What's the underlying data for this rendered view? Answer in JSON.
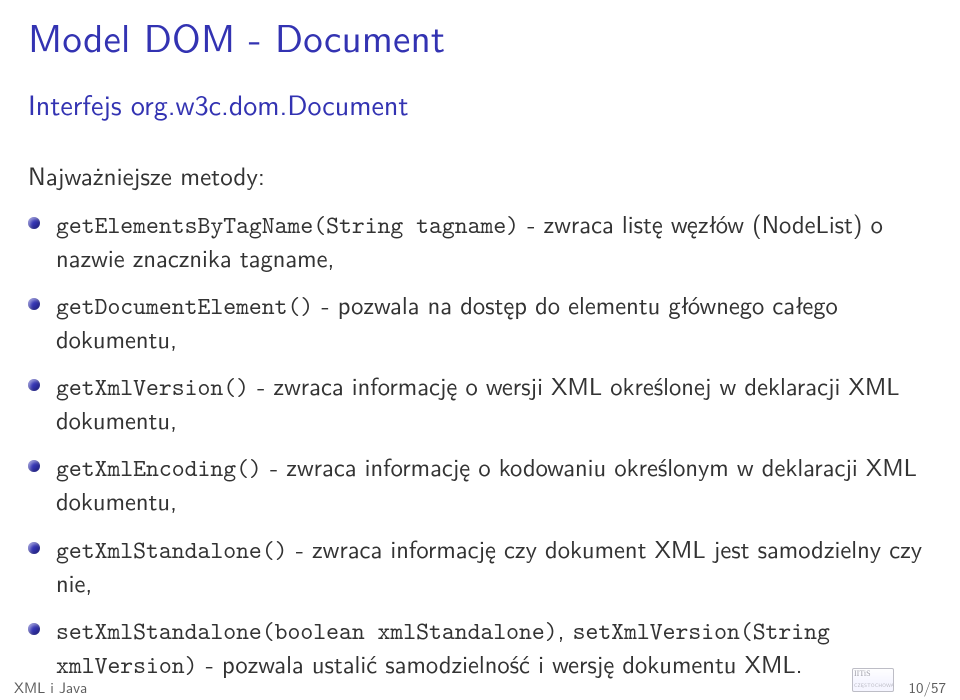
{
  "title": "Model DOM - Document",
  "subtitle": "Interfejs org.w3c.dom.Document",
  "block_title": "Najważniejsze metody:",
  "items": [
    {
      "code": "getElementsByTagName(String tagname)",
      "rest": " - zwraca listę węzłów (NodeList) o nazwie znacznika tagname,"
    },
    {
      "code": "getDocumentElement()",
      "rest": " - pozwala na dostęp do elementu głównego całego dokumentu,"
    },
    {
      "code": "getXmlVersion()",
      "rest": " - zwraca informację o wersji XML określonej w deklaracji XML dokumentu,"
    },
    {
      "code": "getXmlEncoding()",
      "rest": " - zwraca informację o kodowaniu określonym w deklaracji XML dokumentu,"
    },
    {
      "code": "getXmlStandalone()",
      "rest": " - zwraca informację czy dokument XML jest samodzielny czy nie,"
    },
    {
      "code": "setXmlStandalone(boolean xmlStandalone)",
      "rest": ", ",
      "code2": "setXmlVersion(String xmlVersion)",
      "rest2": " - pozwala ustalić samodzielność i wersję dokumentu XML."
    }
  ],
  "footer_left": "XML i Java",
  "footer_right": "10/57"
}
